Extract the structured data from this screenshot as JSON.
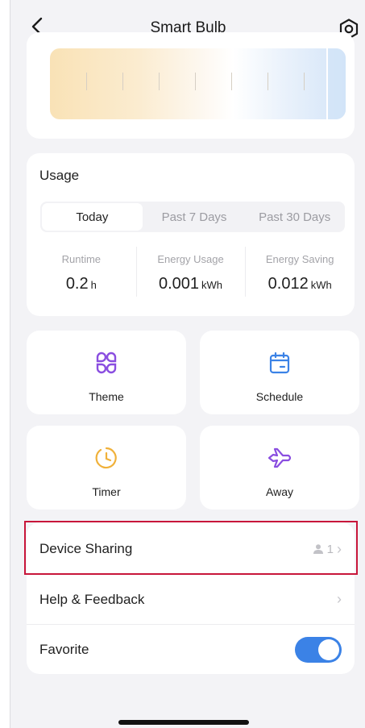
{
  "header": {
    "title": "Smart Bulb",
    "back_icon": "chevron-left-icon",
    "settings_icon": "hexagon-settings-icon"
  },
  "brightness": {
    "level": 0.94
  },
  "usage": {
    "title": "Usage",
    "tabs": [
      {
        "label": "Today",
        "active": true
      },
      {
        "label": "Past 7 Days",
        "active": false
      },
      {
        "label": "Past 30 Days",
        "active": false
      }
    ],
    "stats": [
      {
        "label": "Runtime",
        "value": "0.2",
        "unit": "h"
      },
      {
        "label": "Energy Usage",
        "value": "0.001",
        "unit": "kWh"
      },
      {
        "label": "Energy Saving",
        "value": "0.012",
        "unit": "kWh"
      }
    ]
  },
  "tiles": {
    "theme": {
      "label": "Theme",
      "icon": "theme-icon",
      "color": "#8a4ee0"
    },
    "schedule": {
      "label": "Schedule",
      "icon": "calendar-icon",
      "color": "#3b82e6"
    },
    "timer": {
      "label": "Timer",
      "icon": "clock-icon",
      "color": "#f0b13a"
    },
    "away": {
      "label": "Away",
      "icon": "airplane-icon",
      "color": "#8a4ee0"
    }
  },
  "list": {
    "device_sharing": {
      "label": "Device Sharing",
      "count": "1"
    },
    "help": {
      "label": "Help & Feedback"
    },
    "favorite": {
      "label": "Favorite",
      "enabled": true
    }
  },
  "colors": {
    "accent": "#3b82e6",
    "highlight": "#c8163a"
  }
}
